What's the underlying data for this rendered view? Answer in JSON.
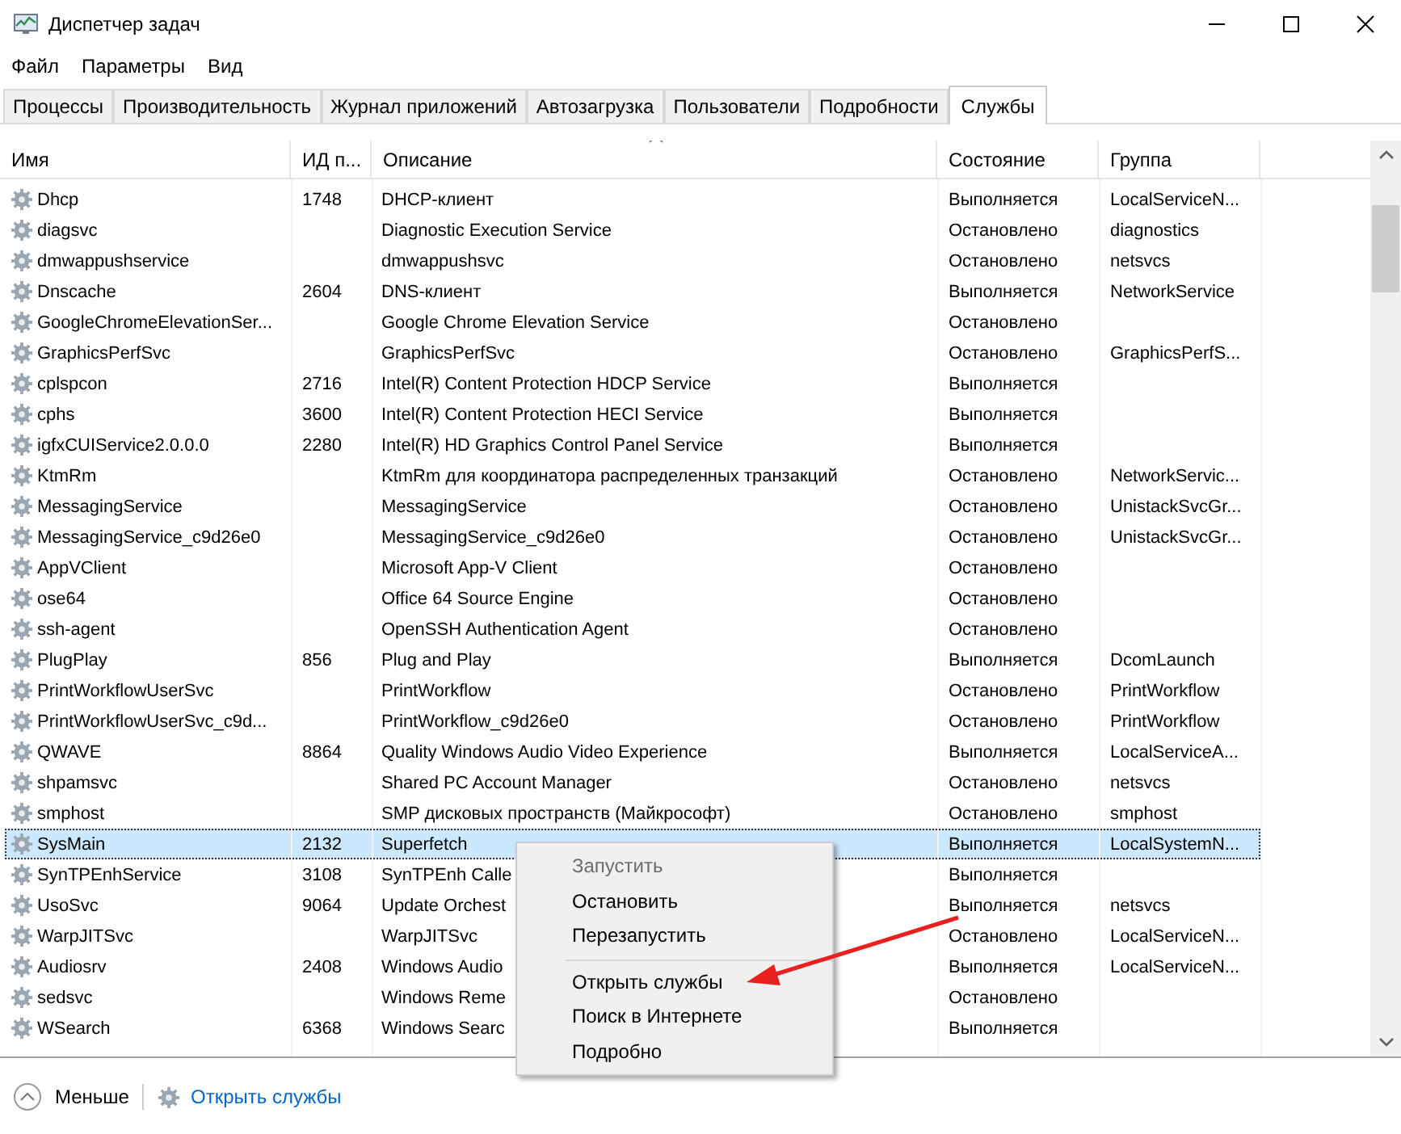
{
  "window": {
    "title": "Диспетчер задач"
  },
  "menu": [
    "Файл",
    "Параметры",
    "Вид"
  ],
  "tabs": [
    {
      "label": "Процессы",
      "selected": false
    },
    {
      "label": "Производительность",
      "selected": false
    },
    {
      "label": "Журнал приложений",
      "selected": false
    },
    {
      "label": "Автозагрузка",
      "selected": false
    },
    {
      "label": "Пользователи",
      "selected": false
    },
    {
      "label": "Подробности",
      "selected": false
    },
    {
      "label": "Службы",
      "selected": true
    }
  ],
  "table": {
    "columns": [
      "Имя",
      "ИД п...",
      "Описание",
      "Состояние",
      "Группа"
    ],
    "rows": [
      {
        "name": "Dhcp",
        "pid": "1748",
        "description": "DHCP-клиент",
        "status": "Выполняется",
        "group": "LocalServiceN...",
        "selected": false
      },
      {
        "name": "diagsvc",
        "pid": "",
        "description": "Diagnostic Execution Service",
        "status": "Остановлено",
        "group": "diagnostics",
        "selected": false
      },
      {
        "name": "dmwappushservice",
        "pid": "",
        "description": "dmwappushsvc",
        "status": "Остановлено",
        "group": "netsvcs",
        "selected": false
      },
      {
        "name": "Dnscache",
        "pid": "2604",
        "description": "DNS-клиент",
        "status": "Выполняется",
        "group": "NetworkService",
        "selected": false
      },
      {
        "name": "GoogleChromeElevationSer...",
        "pid": "",
        "description": "Google Chrome Elevation Service",
        "status": "Остановлено",
        "group": "",
        "selected": false
      },
      {
        "name": "GraphicsPerfSvc",
        "pid": "",
        "description": "GraphicsPerfSvc",
        "status": "Остановлено",
        "group": "GraphicsPerfS...",
        "selected": false
      },
      {
        "name": "cplspcon",
        "pid": "2716",
        "description": "Intel(R) Content Protection HDCP Service",
        "status": "Выполняется",
        "group": "",
        "selected": false
      },
      {
        "name": "cphs",
        "pid": "3600",
        "description": "Intel(R) Content Protection HECI Service",
        "status": "Выполняется",
        "group": "",
        "selected": false
      },
      {
        "name": "igfxCUIService2.0.0.0",
        "pid": "2280",
        "description": "Intel(R) HD Graphics Control Panel Service",
        "status": "Выполняется",
        "group": "",
        "selected": false
      },
      {
        "name": "KtmRm",
        "pid": "",
        "description": "KtmRm для координатора распределенных транзакций",
        "status": "Остановлено",
        "group": "NetworkServic...",
        "selected": false
      },
      {
        "name": "MessagingService",
        "pid": "",
        "description": "MessagingService",
        "status": "Остановлено",
        "group": "UnistackSvcGr...",
        "selected": false
      },
      {
        "name": "MessagingService_c9d26e0",
        "pid": "",
        "description": "MessagingService_c9d26e0",
        "status": "Остановлено",
        "group": "UnistackSvcGr...",
        "selected": false
      },
      {
        "name": "AppVClient",
        "pid": "",
        "description": "Microsoft App-V Client",
        "status": "Остановлено",
        "group": "",
        "selected": false
      },
      {
        "name": "ose64",
        "pid": "",
        "description": "Office 64 Source Engine",
        "status": "Остановлено",
        "group": "",
        "selected": false
      },
      {
        "name": "ssh-agent",
        "pid": "",
        "description": "OpenSSH Authentication Agent",
        "status": "Остановлено",
        "group": "",
        "selected": false
      },
      {
        "name": "PlugPlay",
        "pid": "856",
        "description": "Plug and Play",
        "status": "Выполняется",
        "group": "DcomLaunch",
        "selected": false
      },
      {
        "name": "PrintWorkflowUserSvc",
        "pid": "",
        "description": "PrintWorkflow",
        "status": "Остановлено",
        "group": "PrintWorkflow",
        "selected": false
      },
      {
        "name": "PrintWorkflowUserSvc_c9d...",
        "pid": "",
        "description": "PrintWorkflow_c9d26e0",
        "status": "Остановлено",
        "group": "PrintWorkflow",
        "selected": false
      },
      {
        "name": "QWAVE",
        "pid": "8864",
        "description": "Quality Windows Audio Video Experience",
        "status": "Выполняется",
        "group": "LocalServiceA...",
        "selected": false
      },
      {
        "name": "shpamsvc",
        "pid": "",
        "description": "Shared PC Account Manager",
        "status": "Остановлено",
        "group": "netsvcs",
        "selected": false
      },
      {
        "name": "smphost",
        "pid": "",
        "description": "SMP дисковых пространств (Майкрософт)",
        "status": "Остановлено",
        "group": "smphost",
        "selected": false
      },
      {
        "name": "SysMain",
        "pid": "2132",
        "description": "Superfetch",
        "status": "Выполняется",
        "group": "LocalSystemN...",
        "selected": true
      },
      {
        "name": "SynTPEnhService",
        "pid": "3108",
        "description": "SynTPEnh Calle",
        "status": "Выполняется",
        "group": "",
        "selected": false
      },
      {
        "name": "UsoSvc",
        "pid": "9064",
        "description": "Update Orchest",
        "status": "Выполняется",
        "group": "netsvcs",
        "selected": false
      },
      {
        "name": "WarpJITSvc",
        "pid": "",
        "description": "WarpJITSvc",
        "status": "Остановлено",
        "group": "LocalServiceN...",
        "selected": false
      },
      {
        "name": "Audiosrv",
        "pid": "2408",
        "description": "Windows Audio",
        "status": "Выполняется",
        "group": "LocalServiceN...",
        "selected": false
      },
      {
        "name": "sedsvc",
        "pid": "",
        "description": "Windows Reme",
        "status": "Остановлено",
        "group": "",
        "selected": false
      },
      {
        "name": "WSearch",
        "pid": "6368",
        "description": "Windows Searc",
        "status": "Выполняется",
        "group": "",
        "selected": false
      }
    ]
  },
  "context_menu": [
    {
      "kind": "item",
      "label": "Запустить",
      "disabled": true
    },
    {
      "kind": "item",
      "label": "Остановить",
      "disabled": false
    },
    {
      "kind": "item",
      "label": "Перезапустить",
      "disabled": false
    },
    {
      "kind": "separator"
    },
    {
      "kind": "item",
      "label": "Открыть службы",
      "disabled": false
    },
    {
      "kind": "item",
      "label": "Поиск в Интернете",
      "disabled": false
    },
    {
      "kind": "item",
      "label": "Подробно",
      "disabled": false
    }
  ],
  "footer": {
    "less": "Меньше",
    "open_services": "Открыть службы"
  }
}
